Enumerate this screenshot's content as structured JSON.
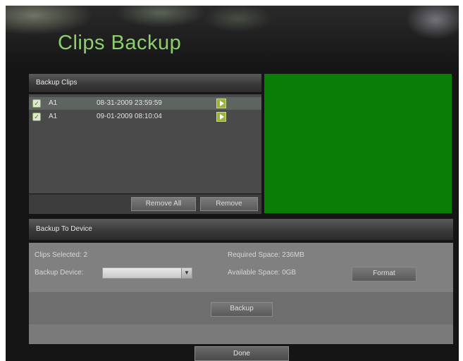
{
  "page": {
    "title": "Clips Backup"
  },
  "backup_clips": {
    "header": "Backup Clips",
    "clips": [
      {
        "camera": "A1",
        "timestamp": "08-31-2009 23:59:59",
        "checked": true,
        "selected": true,
        "play_icon": "play-icon"
      },
      {
        "camera": "A1",
        "timestamp": "09-01-2009 08:10:04",
        "checked": true,
        "selected": false,
        "play_icon": "play-icon"
      }
    ],
    "remove_all_label": "Remove All",
    "remove_label": "Remove"
  },
  "preview": {
    "color": "#0a7d06"
  },
  "backup_to_device": {
    "header": "Backup To Device",
    "clips_selected": "Clips Selected: 2",
    "required_space": "Required Space: 236MB",
    "backup_device_label": "Backup Device:",
    "backup_device_value": "",
    "available_space": "Available Space: 0GB",
    "format_label": "Format",
    "backup_label": "Backup"
  },
  "footer": {
    "done_label": "Done"
  },
  "colors": {
    "title": "#8ccf6c",
    "preview_green": "#0a7d06",
    "play_button": "#9ab43a"
  }
}
